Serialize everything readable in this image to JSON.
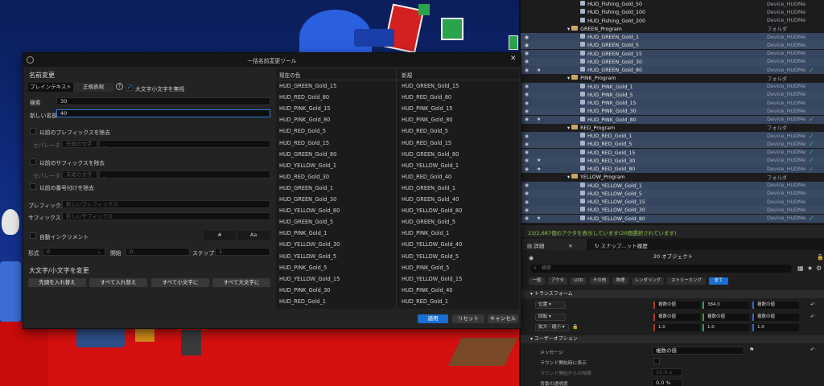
{
  "outliner": {
    "rows": [
      {
        "name": "HUD_Fishing_Gold_50",
        "type": "Device_HUDMe",
        "kind": "actor",
        "sel": false,
        "eye": false,
        "star": false,
        "check": false,
        "indent": 74
      },
      {
        "name": "HUD_Fishing_Gold_100",
        "type": "Device_HUDMe",
        "kind": "actor",
        "sel": false,
        "eye": false,
        "star": false,
        "check": false,
        "indent": 74
      },
      {
        "name": "HUD_Fishing_Gold_200",
        "type": "Device_HUDMe",
        "kind": "actor",
        "sel": false,
        "eye": false,
        "star": false,
        "check": false,
        "indent": 74
      },
      {
        "name": "GREEN_Program",
        "type": "フォルダ",
        "kind": "folder",
        "sel": false,
        "eye": false,
        "star": false,
        "check": false,
        "indent": 58
      },
      {
        "name": "HUD_GREEN_Gold_1",
        "type": "Device_HUDMe",
        "kind": "actor",
        "sel": true,
        "eye": true,
        "star": false,
        "check": false,
        "indent": 74
      },
      {
        "name": "HUD_GREEN_Gold_5",
        "type": "Device_HUDMe",
        "kind": "actor",
        "sel": true,
        "eye": true,
        "star": false,
        "check": false,
        "indent": 74
      },
      {
        "name": "HUD_GREEN_Gold_15",
        "type": "Device_HUDMe",
        "kind": "actor",
        "sel": true,
        "eye": true,
        "star": false,
        "check": false,
        "indent": 74
      },
      {
        "name": "HUD_GREEN_Gold_30",
        "type": "Device_HUDMe",
        "kind": "actor",
        "sel": true,
        "eye": true,
        "star": false,
        "check": false,
        "indent": 74
      },
      {
        "name": "HUD_GREEN_Gold_80",
        "type": "Device_HUDMe",
        "kind": "actor",
        "sel": true,
        "eye": true,
        "star": true,
        "check": true,
        "indent": 74
      },
      {
        "name": "PINK_Program",
        "type": "フォルダ",
        "kind": "folder",
        "sel": false,
        "eye": false,
        "star": false,
        "check": false,
        "indent": 58
      },
      {
        "name": "HUD_PINK_Gold_1",
        "type": "Device_HUDMe",
        "kind": "actor",
        "sel": true,
        "eye": true,
        "star": false,
        "check": false,
        "indent": 74
      },
      {
        "name": "HUD_PINK_Gold_5",
        "type": "Device_HUDMe",
        "kind": "actor",
        "sel": true,
        "eye": true,
        "star": false,
        "check": false,
        "indent": 74
      },
      {
        "name": "HUD_PINK_Gold_15",
        "type": "Device_HUDMe",
        "kind": "actor",
        "sel": true,
        "eye": true,
        "star": false,
        "check": false,
        "indent": 74
      },
      {
        "name": "HUD_PINK_Gold_30",
        "type": "Device_HUDMe",
        "kind": "actor",
        "sel": true,
        "eye": true,
        "star": false,
        "check": false,
        "indent": 74
      },
      {
        "name": "HUD_PINK_Gold_80",
        "type": "Device_HUDMe",
        "kind": "actor",
        "sel": true,
        "eye": true,
        "star": true,
        "check": true,
        "indent": 74
      },
      {
        "name": "RED_Program",
        "type": "フォルダ",
        "kind": "folder",
        "sel": false,
        "eye": false,
        "star": false,
        "check": false,
        "indent": 58
      },
      {
        "name": "HUD_RED_Gold_1",
        "type": "Device_HUDMe",
        "kind": "actor",
        "sel": true,
        "eye": true,
        "star": false,
        "check": true,
        "indent": 74
      },
      {
        "name": "HUD_RED_Gold_5",
        "type": "Device_HUDMe",
        "kind": "actor",
        "sel": true,
        "eye": true,
        "star": false,
        "check": true,
        "indent": 74
      },
      {
        "name": "HUD_RED_Gold_15",
        "type": "Device_HUDMe",
        "kind": "actor",
        "sel": true,
        "eye": true,
        "star": false,
        "check": true,
        "indent": 74
      },
      {
        "name": "HUD_RED_Gold_30",
        "type": "Device_HUDMe",
        "kind": "actor",
        "sel": true,
        "eye": true,
        "star": true,
        "check": true,
        "indent": 74
      },
      {
        "name": "HUD_RED_Gold_80",
        "type": "Device_HUDMe",
        "kind": "actor",
        "sel": true,
        "eye": true,
        "star": true,
        "check": true,
        "indent": 74
      },
      {
        "name": "YELLOW_Program",
        "type": "フォルダ",
        "kind": "folder",
        "sel": false,
        "eye": false,
        "star": false,
        "check": false,
        "indent": 58
      },
      {
        "name": "HUD_YELLOW_Gold_1",
        "type": "Device_HUDMe",
        "kind": "actor",
        "sel": true,
        "eye": true,
        "star": false,
        "check": false,
        "indent": 74
      },
      {
        "name": "HUD_YELLOW_Gold_5",
        "type": "Device_HUDMe",
        "kind": "actor",
        "sel": true,
        "eye": true,
        "star": false,
        "check": false,
        "indent": 74
      },
      {
        "name": "HUD_YELLOW_Gold_15",
        "type": "Device_HUDMe",
        "kind": "actor",
        "sel": true,
        "eye": true,
        "star": false,
        "check": false,
        "indent": 74
      },
      {
        "name": "HUD_YELLOW_Gold_30",
        "type": "Device_HUDMe",
        "kind": "actor",
        "sel": true,
        "eye": true,
        "star": false,
        "check": false,
        "indent": 74
      },
      {
        "name": "HUD_YELLOW_Gold_80",
        "type": "Device_HUDMe",
        "kind": "actor",
        "sel": true,
        "eye": true,
        "star": true,
        "check": true,
        "indent": 74
      }
    ],
    "status": "23/2,687個のアクタを表示しています(20個選択されています)"
  },
  "details": {
    "tab_details": "詳細",
    "tab_snapshot": "スナップ...ット履歴",
    "title": "20 オブジェクト",
    "search_placeholder": "検索",
    "filters": [
      "一般",
      "アクタ",
      "LOD",
      "その他",
      "物理",
      "レンダリング",
      "ストリーミング",
      "全て"
    ],
    "section_transform": "トランスフォーム",
    "location_label": "位置",
    "rotation_label": "回転",
    "scale_label": "拡大・縮小",
    "loc_x": "複数の値",
    "loc_y": "384.0",
    "loc_z": "複数の値",
    "rot_x": "複数の値",
    "rot_y": "複数の値",
    "rot_z": "複数の値",
    "scale_x": "1.0",
    "scale_y": "1.0",
    "scale_z": "1.0",
    "section_user": "ユーザーオプション",
    "message_label": "メッセージ",
    "message_value": "複数の値",
    "show_on_round_start": "ラウンド開始時に表示",
    "time_from_round_start": "ラウンド開始からの時間",
    "time_value": "10.0 s",
    "opacity_label": "背景の透明度",
    "opacity_value": "0.0 %"
  },
  "dialog": {
    "title": "一括名前変更ツール",
    "section_rename": "名前変更",
    "mode_plain": "プレインテキスト",
    "mode_regex": "正規表現",
    "ignore_case_label": "大文字小文字を無視",
    "ignore_case_checked": true,
    "search_label": "検索",
    "search_value": "30",
    "new_name_label": "新しい名前",
    "new_name_value": "40",
    "remove_prefix_label": "以前のプレフィックスを除去",
    "separator_label": "セパレータ",
    "leading_chars_placeholder": "先頭の文字",
    "separator_value_1": "_",
    "remove_suffix_label": "以前のサフィックスを除去",
    "separator_label_2": "セパレータ",
    "trailing_chars_placeholder": "末尾の文字",
    "separator_value_2": "_",
    "remove_numbering_label": "以前の番号付けを除去",
    "prefix_label": "プレフィックス",
    "prefix_placeholder": "新しいプレフィックス",
    "suffix_label": "サフィックス",
    "suffix_placeholder": "新しいサフィックス",
    "auto_increment_label": "自動インクリメント",
    "hash_label": "#",
    "aa_label": "Aa",
    "format_label": "形式",
    "format_value": "0",
    "start_label": "開始",
    "start_value": "0",
    "step_label": "ステップ",
    "step_value": "1",
    "section_case": "大文字/小文字を変更",
    "case_first": "先頭を入れ替え",
    "case_swap": "すべて入れ替え",
    "case_lower": "すべて小文字に",
    "case_upper": "すべて大文字に",
    "col_current": "現在の色",
    "col_new": "新規",
    "current_names": [
      "HUD_GREEN_Gold_15",
      "HUD_RED_Gold_80",
      "HUD_PINK_Gold_15",
      "HUD_PINK_Gold_80",
      "HUD_RED_Gold_5",
      "HUD_RED_Gold_15",
      "HUD_GREEN_Gold_80",
      "HUD_YELLOW_Gold_1",
      "HUD_RED_Gold_30",
      "HUD_GREEN_Gold_1",
      "HUD_GREEN_Gold_30",
      "HUD_YELLOW_Gold_80",
      "HUD_GREEN_Gold_5",
      "HUD_PINK_Gold_1",
      "HUD_YELLOW_Gold_30",
      "HUD_YELLOW_Gold_5",
      "HUD_PINK_Gold_5",
      "HUD_YELLOW_Gold_15",
      "HUD_PINK_Gold_30",
      "HUD_RED_Gold_1"
    ],
    "new_names": [
      "HUD_GREEN_Gold_15",
      "HUD_RED_Gold_80",
      "HUD_PINK_Gold_15",
      "HUD_PINK_Gold_80",
      "HUD_RED_Gold_5",
      "HUD_RED_Gold_15",
      "HUD_GREEN_Gold_80",
      "HUD_YELLOW_Gold_1",
      "HUD_RED_Gold_40",
      "HUD_GREEN_Gold_1",
      "HUD_GREEN_Gold_40",
      "HUD_YELLOW_Gold_80",
      "HUD_GREEN_Gold_5",
      "HUD_PINK_Gold_1",
      "HUD_YELLOW_Gold_40",
      "HUD_YELLOW_Gold_5",
      "HUD_PINK_Gold_5",
      "HUD_YELLOW_Gold_15",
      "HUD_PINK_Gold_40",
      "HUD_RED_Gold_1"
    ],
    "apply_label": "適用",
    "reset_label": "リセット",
    "cancel_label": "キャンセル"
  },
  "colors": {
    "accent": "#1b6ed1",
    "selection": "#3a4a63",
    "check_green": "#3fbf4a",
    "floor_red": "#c80b0b",
    "sky_blue": "#12308a"
  }
}
